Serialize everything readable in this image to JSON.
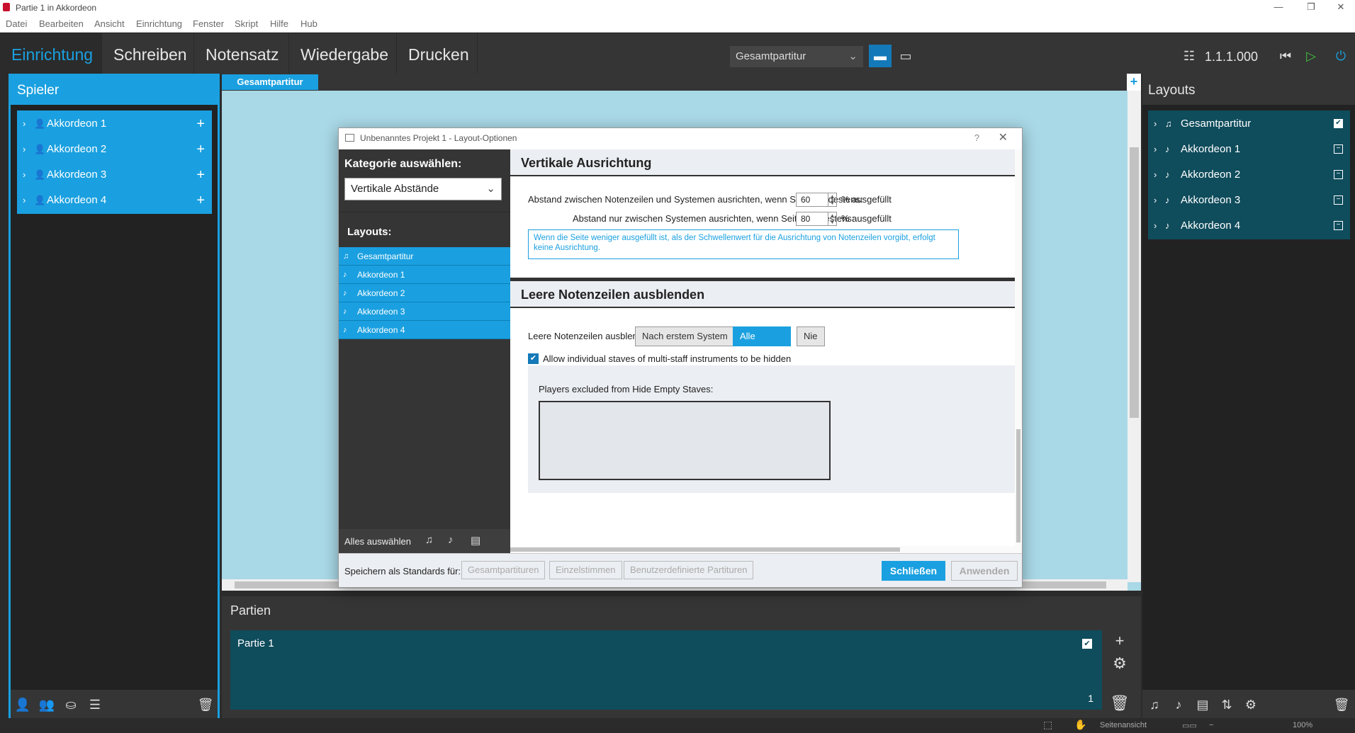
{
  "window": {
    "title": "Partie 1 in Akkordeon"
  },
  "menu": [
    "Datei",
    "Bearbeiten",
    "Ansicht",
    "Einrichtung",
    "Fenster",
    "Skript",
    "Hilfe",
    "Hub"
  ],
  "modes": [
    "Einrichtung",
    "Schreiben",
    "Notensatz",
    "Wiedergabe",
    "Drucken"
  ],
  "toolbar": {
    "layout_select": "Gesamtpartitur",
    "position": "1.1.1.000"
  },
  "players": {
    "header": "Spieler",
    "items": [
      "Akkordeon 1",
      "Akkordeon 2",
      "Akkordeon 3",
      "Akkordeon 4"
    ]
  },
  "center": {
    "tab": "Gesamtpartitur"
  },
  "parts": {
    "header": "Partien",
    "row_label": "Partie 1",
    "row_count": "1"
  },
  "layouts": {
    "header": "Layouts",
    "items": [
      "Gesamtpartitur",
      "Akkordeon 1",
      "Akkordeon 2",
      "Akkordeon 3",
      "Akkordeon 4"
    ]
  },
  "statusbar": {
    "view": "Seitenansicht",
    "zoom": "100%"
  },
  "dialog": {
    "title": "Unbenanntes Projekt 1 - Layout-Optionen",
    "category_heading": "Kategorie auswählen:",
    "category_value": "Vertikale Abstände",
    "layouts_heading": "Layouts:",
    "layouts": [
      "Gesamtpartitur",
      "Akkordeon 1",
      "Akkordeon 2",
      "Akkordeon 3",
      "Akkordeon 4"
    ],
    "select_all": "Alles auswählen",
    "section1": {
      "title": "Vertikale Ausrichtung",
      "row1_label": "Abstand zwischen Notenzeilen und Systemen ausrichten, wenn Seite mindestens:",
      "row1_value": "60",
      "row2_label": "Abstand nur zwischen Systemen ausrichten, wenn Seite mindestens:",
      "row2_value": "80",
      "unit": "% ausgefüllt",
      "info": "Wenn die Seite weniger ausgefüllt ist, als der Schwellenwert für die Ausrichtung von Notenzeilen vorgibt, erfolgt keine Ausrichtung."
    },
    "section2": {
      "title": "Leere Notenzeilen ausblenden",
      "hide_label": "Leere Notenzeilen ausblenden:",
      "options": [
        "Nach erstem System",
        "Alle Systeme",
        "Nie"
      ],
      "selected": "Alle Systeme",
      "checkbox_label": "Allow individual staves of multi-staff instruments to be hidden",
      "excluded_label": "Players excluded from Hide Empty Staves:"
    },
    "footer": {
      "save_label": "Speichern als Standards für:",
      "defaults": [
        "Gesamtpartituren",
        "Einzelstimmen",
        "Benutzerdefinierte Partituren"
      ],
      "close": "Schließen",
      "apply": "Anwenden"
    }
  }
}
